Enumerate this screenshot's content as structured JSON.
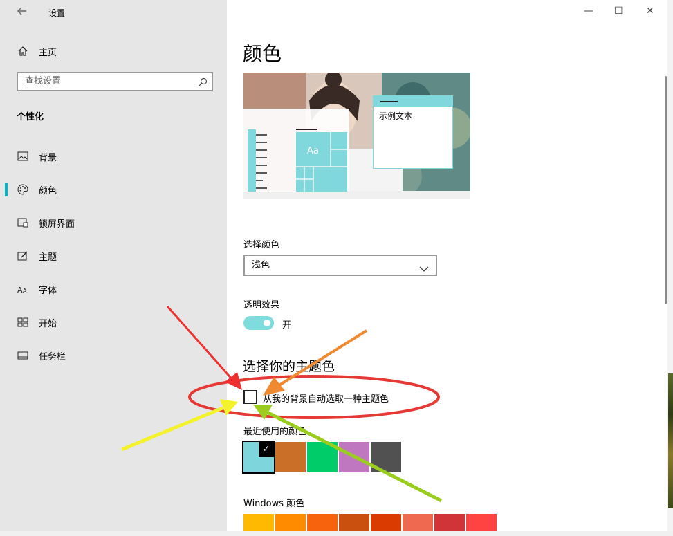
{
  "window": {
    "title": "设置",
    "minimize": "—",
    "maximize": "☐",
    "close": "✕"
  },
  "sidebar": {
    "back_icon": "back-arrow-icon",
    "home": "主页",
    "search_placeholder": "查找设置",
    "section": "个性化",
    "items": [
      {
        "label": "背景",
        "icon": "picture-icon"
      },
      {
        "label": "颜色",
        "icon": "palette-icon"
      },
      {
        "label": "锁屏界面",
        "icon": "lock-screen-icon"
      },
      {
        "label": "主题",
        "icon": "theme-icon"
      },
      {
        "label": "字体",
        "icon": "font-icon"
      },
      {
        "label": "开始",
        "icon": "start-icon"
      },
      {
        "label": "任务栏",
        "icon": "taskbar-icon"
      }
    ],
    "selected_index": 1,
    "accent": "#00b7c3"
  },
  "main": {
    "title": "颜色",
    "preview": {
      "sample_text": "示例文本",
      "tile_text": "Aa",
      "accent": "#80d8dc"
    },
    "choose_color_label": "选择颜色",
    "choose_color_value": "浅色",
    "transparency_label": "透明效果",
    "transparency_state": "开",
    "theme_heading": "选择你的主题色",
    "auto_pick_label": "从我的背景自动选取一种主题色",
    "auto_pick_checked": false,
    "recent_label": "最近使用的颜色",
    "recent_colors": [
      "#7fd5dc",
      "#ca6f28",
      "#00cc6a",
      "#bf77bf",
      "#515151"
    ],
    "windows_label": "Windows 颜色",
    "windows_colors": [
      "#ffb900",
      "#ff8c00",
      "#f7630c",
      "#ca5010",
      "#da3b01",
      "#ef6950",
      "#d13438",
      "#ff4343"
    ]
  },
  "annotations": {
    "ellipse_color": "#e53935",
    "arrow_colors": [
      "#ee3030",
      "#f08a30",
      "#f4f22a",
      "#9acd20"
    ]
  }
}
